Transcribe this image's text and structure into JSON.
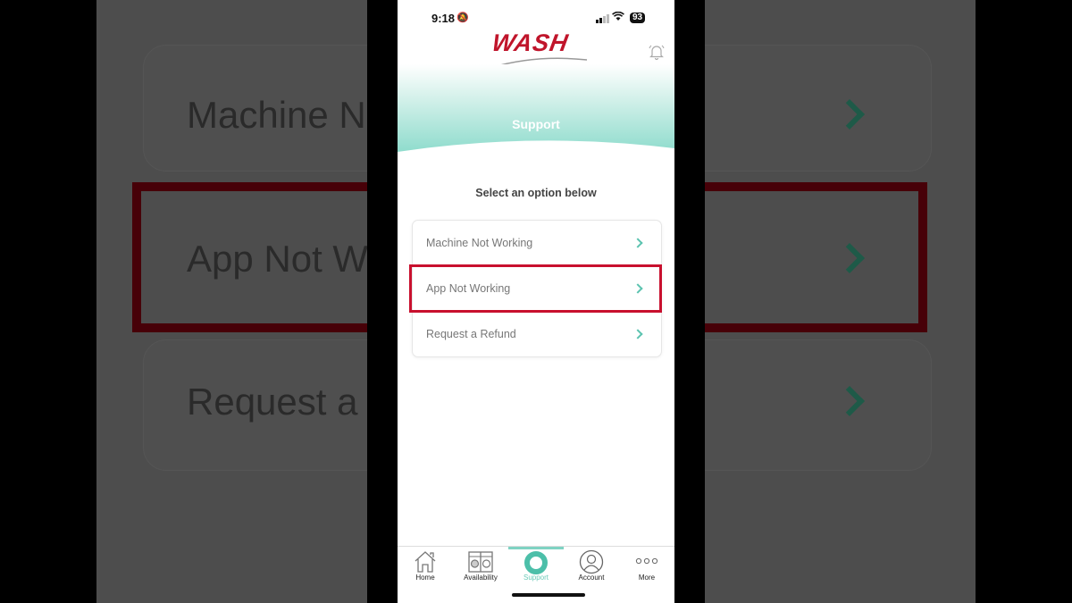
{
  "status_bar": {
    "time": "9:18",
    "battery": "93"
  },
  "app": {
    "brand": "WASH",
    "brand_color": "#c0152b",
    "accent_color": "#5cc3b0"
  },
  "header": {
    "title": "Support",
    "notification_icon": "bell-icon"
  },
  "main": {
    "subtitle": "Select an option below",
    "options": [
      {
        "label": "Machine Not Working",
        "icon": "chevron-right-icon"
      },
      {
        "label": "App Not Working",
        "icon": "chevron-right-icon",
        "highlighted": true
      },
      {
        "label": "Request a Refund",
        "icon": "chevron-right-icon"
      }
    ]
  },
  "tabbar": {
    "tabs": [
      {
        "label": "Home",
        "icon": "home-icon"
      },
      {
        "label": "Availability",
        "icon": "washer-dryer-icon"
      },
      {
        "label": "Support",
        "icon": "lifebuoy-icon",
        "active": true
      },
      {
        "label": "Account",
        "icon": "user-icon"
      },
      {
        "label": "More",
        "icon": "more-dots-icon"
      }
    ]
  },
  "background_zoom": {
    "left_texts": [
      "Machine No",
      "App Not Wo",
      "Request a"
    ]
  }
}
